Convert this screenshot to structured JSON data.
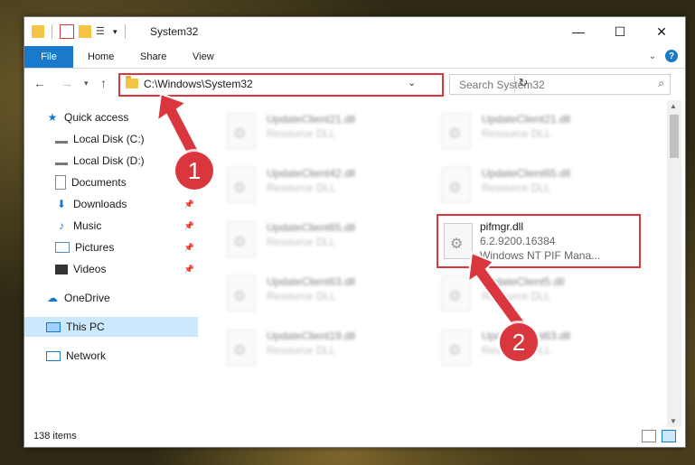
{
  "window": {
    "title": "System32"
  },
  "ribbon": {
    "file": "File",
    "tabs": [
      "Home",
      "Share",
      "View"
    ]
  },
  "address": {
    "path": "C:\\Windows\\System32"
  },
  "search": {
    "placeholder": "Search System32"
  },
  "nav": {
    "items": [
      {
        "label": "Quick access",
        "icon": "star-icon"
      },
      {
        "label": "Local Disk (C:)",
        "icon": "drive-icon"
      },
      {
        "label": "Local Disk (D:)",
        "icon": "drive-icon"
      },
      {
        "label": "Documents",
        "icon": "document-icon"
      },
      {
        "label": "Downloads",
        "icon": "download-icon"
      },
      {
        "label": "Music",
        "icon": "music-icon"
      },
      {
        "label": "Pictures",
        "icon": "pictures-icon"
      },
      {
        "label": "Videos",
        "icon": "video-icon"
      },
      {
        "label": "OneDrive",
        "icon": "cloud-icon"
      },
      {
        "label": "This PC",
        "icon": "pc-icon"
      },
      {
        "label": "Network",
        "icon": "network-icon"
      }
    ]
  },
  "files": [
    {
      "name": "UpdateClient21.dll",
      "desc": "Resource DLL"
    },
    {
      "name": "UpdateClient21.dll",
      "desc": "Resource DLL"
    },
    {
      "name": "UpdateClient42.dll",
      "desc": "Resource DLL"
    },
    {
      "name": "UpdateClient65.dll",
      "desc": "Resource DLL"
    },
    {
      "name": "UpdateClient65.dll",
      "desc": "Resource DLL"
    },
    {
      "name": "pifmgr.dll",
      "version": "6.2.9200.16384",
      "desc": "Windows NT PIF Mana..."
    },
    {
      "name": "UpdateClient63.dll",
      "desc": "Resource DLL"
    },
    {
      "name": "UpdateClient5.dll",
      "desc": "Resource DLL"
    },
    {
      "name": "UpdateClient19.dll",
      "desc": "Resource DLL"
    },
    {
      "name": "UpdateClient63.dll",
      "desc": "Resource DLL"
    }
  ],
  "status": {
    "count": "138 items"
  },
  "annotations": {
    "step1": "1",
    "step2": "2"
  },
  "colors": {
    "accent": "#1979ca",
    "highlight": "#d9363e"
  }
}
